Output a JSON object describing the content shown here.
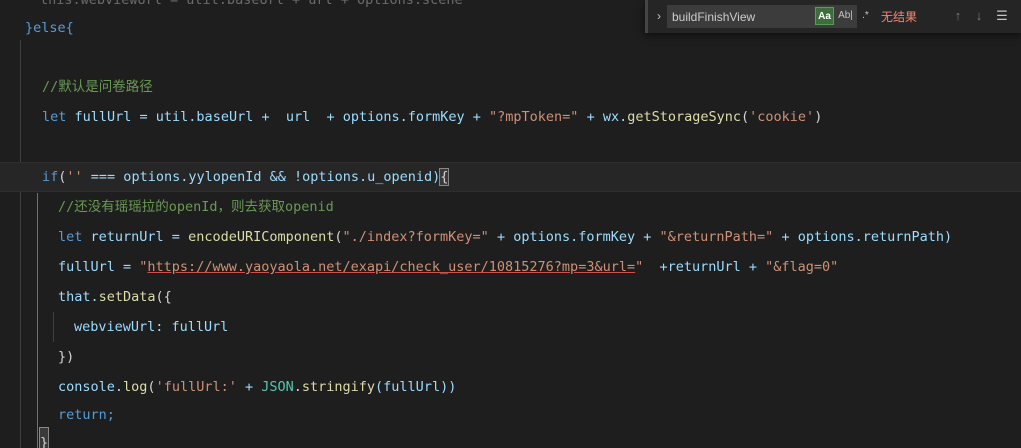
{
  "find": {
    "query": "buildFinishView",
    "toggle_icon": "chevron-right-icon",
    "match_case_label": "Aa",
    "whole_word_label": "Ab|",
    "regex_label": ".*",
    "result": "无结果",
    "prev_icon": "arrow-up-icon",
    "next_icon": "arrow-down-icon",
    "selection_icon": "find-in-selection-icon"
  },
  "code": {
    "l0": "this.webviewUrl = util.baseUrl + url + options.scene",
    "l1": "}else{",
    "l3": "//默认是问卷路径",
    "l4_kw": "let",
    "l4_a": " fullUrl = util.baseUrl +  url  + options.formKey + ",
    "l4_s": "\"?mpToken=\"",
    "l4_b": " + wx.",
    "l4_fn": "getStorageSync",
    "l4_p": "(",
    "l4_s2": "'cookie'",
    "l4_e": ")",
    "l6_kw": "if",
    "l6_p": "(",
    "l6_s": "''",
    "l6_a": " === options.yylopenId && !options.u_openid)",
    "l6_brace": "{",
    "l7": "//还没有瑶瑶拉的openId，则去获取openid",
    "l8_kw": "let",
    "l8_a": " returnUrl = ",
    "l8_fn": "encodeURIComponent",
    "l8_p": "(",
    "l8_s": "\"./index?formKey=\"",
    "l8_b": " + options.formKey + ",
    "l8_s2": "\"&returnPath=\"",
    "l8_c": " + options.returnPath)",
    "l9_a": "fullUrl = ",
    "l9_q1": "\"",
    "l9_url": "https://www.yaoyaola.net/exapi/check_user/10815276?mp=3&url=",
    "l9_q2": "\"",
    "l9_b": "  +returnUrl + ",
    "l9_s": "\"&flag=0\"",
    "l10_a": "that.",
    "l10_fn": "setData",
    "l10_b": "({",
    "l11": "webviewUrl: fullUrl",
    "l12": "})",
    "l13_a": "console.",
    "l13_fn": "log",
    "l13_p": "(",
    "l13_s": "'fullUrl:'",
    "l13_b": " + ",
    "l13_cls": "JSON",
    "l13_c": ".",
    "l13_fn2": "stringify",
    "l13_d": "(fullUrl))",
    "l14": "return;",
    "l15": "}"
  }
}
